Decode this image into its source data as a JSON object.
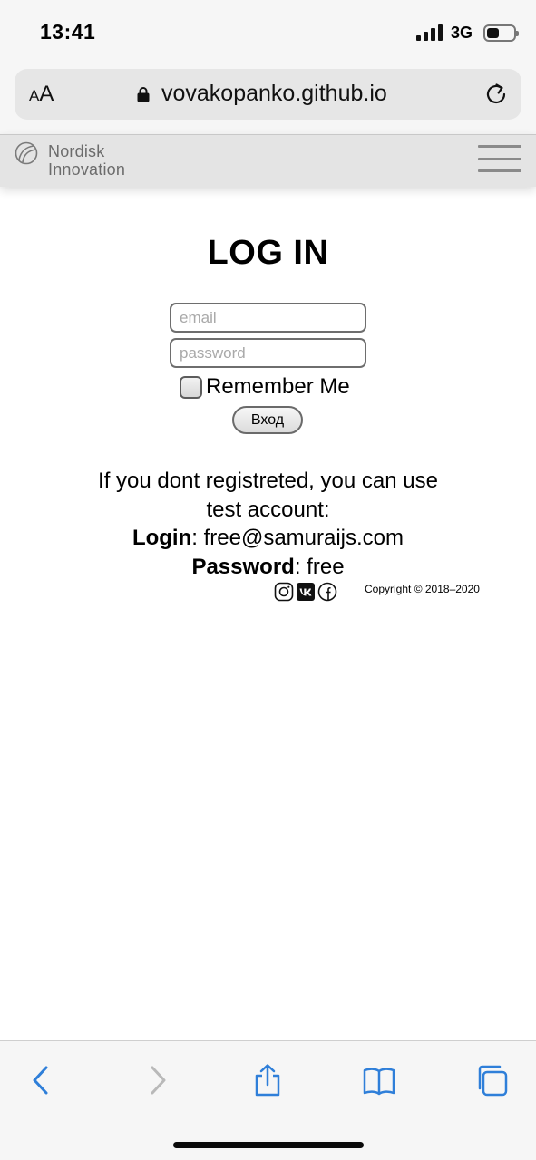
{
  "status_bar": {
    "time": "13:41",
    "network": "3G",
    "signal_bars_filled": 4,
    "battery_level_fraction": 0.4
  },
  "browser": {
    "text_size_button": "AA",
    "url": "vovakopanko.github.io",
    "icons": [
      "lock-icon",
      "reload-icon"
    ]
  },
  "site_header": {
    "logo_line1": "Nordisk",
    "logo_line2": "Innovation",
    "menu_icon": "hamburger-menu-icon"
  },
  "login": {
    "title": "LOG IN",
    "email_placeholder": "email",
    "password_placeholder": "password",
    "email_value": "",
    "password_value": "",
    "remember_label": "Remember Me",
    "remember_checked": false,
    "submit_label": "Вход"
  },
  "info": {
    "line1": "If you dont registreted, you can use",
    "line2": "test account:",
    "login_label": "Login",
    "login_value": ": free@samuraijs.com",
    "password_label": "Password",
    "password_value": ": free"
  },
  "footer": {
    "social_icons": [
      "instagram-icon",
      "vk-icon",
      "facebook-icon"
    ],
    "copyright": "Copyright © 2018–2020"
  },
  "toolbar": {
    "icons": [
      "back-icon",
      "forward-icon",
      "share-icon",
      "bookmarks-icon",
      "tabs-icon"
    ],
    "accent_color": "#2f7fd9",
    "disabled_color": "#b9b9b9"
  }
}
